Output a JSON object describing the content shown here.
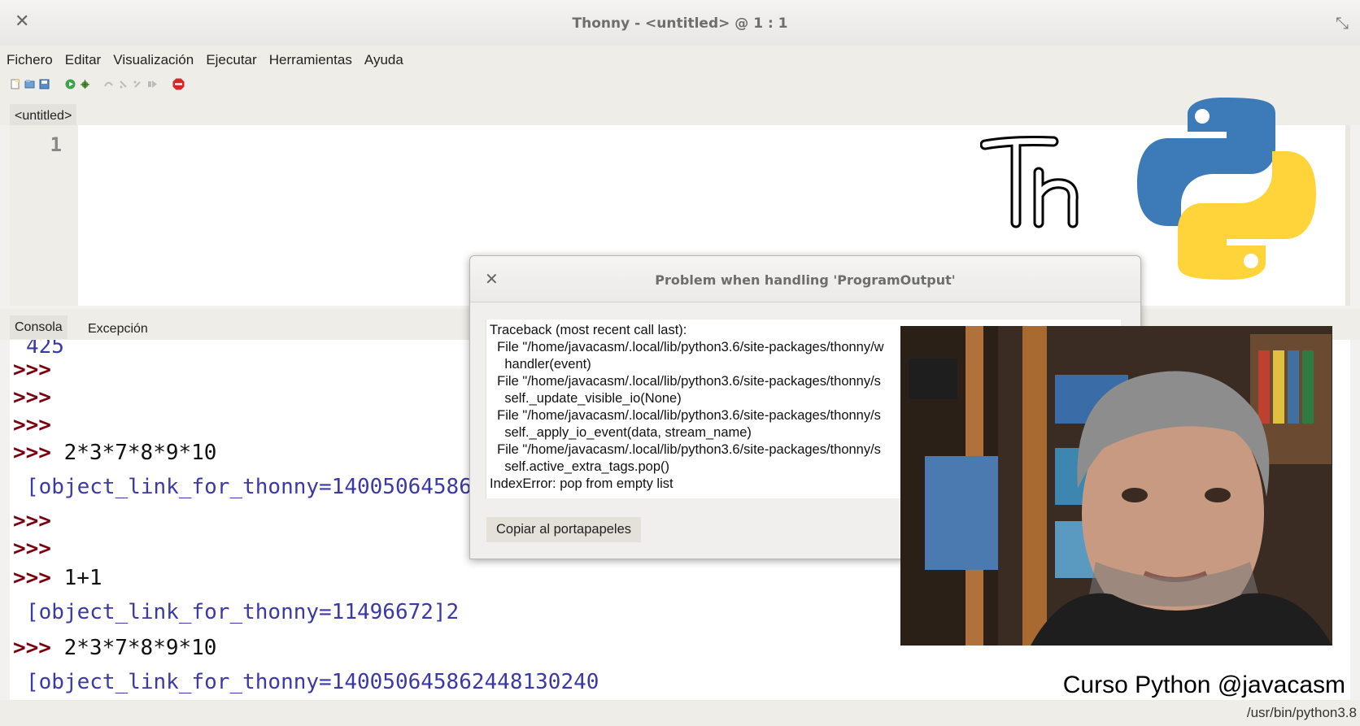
{
  "window": {
    "title": "Thonny - <untitled> @ 1 : 1"
  },
  "menu": [
    "Fichero",
    "Editar",
    "Visualización",
    "Ejecutar",
    "Herramientas",
    "Ayuda"
  ],
  "toolbar": {
    "icons": [
      "new-file-icon",
      "open-file-icon",
      "save-file-icon",
      "run-icon",
      "debug-icon",
      "step-over-icon",
      "step-into-icon",
      "step-out-icon",
      "resume-icon",
      "stop-icon"
    ]
  },
  "editor": {
    "tab": "<untitled>",
    "line_number": "1"
  },
  "logo": {
    "th_text": "Th"
  },
  "console": {
    "tabs": [
      "Consola",
      "Excepción"
    ],
    "lines": [
      {
        "prompt": "",
        "text": "425",
        "kind": "out"
      },
      {
        "prompt": ">>>",
        "text": "",
        "kind": "code"
      },
      {
        "prompt": ">>>",
        "text": "",
        "kind": "code"
      },
      {
        "prompt": ">>>",
        "text": "",
        "kind": "code"
      },
      {
        "prompt": ">>>",
        "text": "2*3*7*8*9*10",
        "kind": "code"
      },
      {
        "prompt": "",
        "text": "[object_link_for_thonny=1400506458624481302",
        "kind": "out"
      },
      {
        "prompt": ">>>",
        "text": "",
        "kind": "code"
      },
      {
        "prompt": ">>>",
        "text": "",
        "kind": "code"
      },
      {
        "prompt": ">>>",
        "text": "1+1",
        "kind": "code"
      },
      {
        "prompt": "",
        "text": "[object_link_for_thonny=11496672]2",
        "kind": "out"
      },
      {
        "prompt": ">>>",
        "text": "2*3*7*8*9*10",
        "kind": "code"
      },
      {
        "prompt": "",
        "text": "[object_link_for_thonny=140050645862448130240",
        "kind": "out"
      }
    ]
  },
  "dialog": {
    "title": "Problem when handling 'ProgramOutput'",
    "traceback": [
      "Traceback (most recent call last):",
      "  File \"/home/javacasm/.local/lib/python3.6/site-packages/thonny/w",
      "    handler(event)",
      "  File \"/home/javacasm/.local/lib/python3.6/site-packages/thonny/s",
      "    self._update_visible_io(None)",
      "  File \"/home/javacasm/.local/lib/python3.6/site-packages/thonny/s",
      "    self._apply_io_event(data, stream_name)",
      "  File \"/home/javacasm/.local/lib/python3.6/site-packages/thonny/s",
      "    self.active_extra_tags.pop()",
      "IndexError: pop from empty list"
    ],
    "copy_button": "Copiar al portapapeles"
  },
  "overlay": {
    "caption": "Curso Python @javacasm"
  },
  "status": {
    "interpreter": "/usr/bin/python3.8"
  },
  "colors": {
    "prompt": "#7a0010",
    "output": "#3a39a6",
    "python_blue": "#3d7ab8",
    "python_yellow": "#ffd43b"
  }
}
